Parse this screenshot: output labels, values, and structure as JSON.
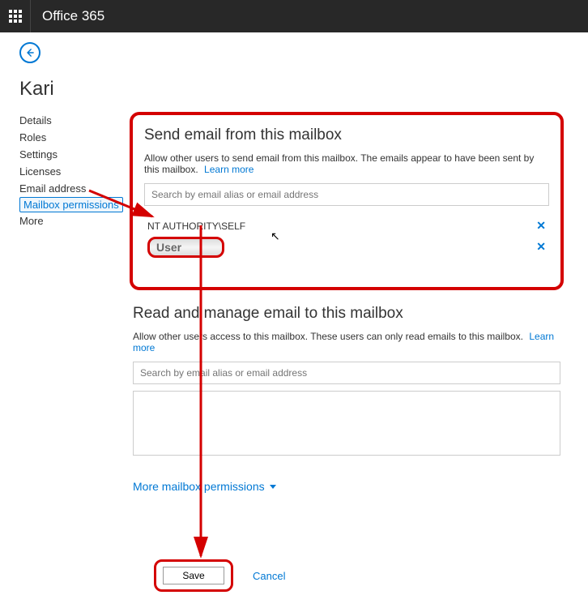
{
  "topbar": {
    "brand": "Office 365"
  },
  "page": {
    "title": "Kari"
  },
  "sidebar": {
    "items": [
      {
        "label": "Details"
      },
      {
        "label": "Roles"
      },
      {
        "label": "Settings"
      },
      {
        "label": "Licenses"
      },
      {
        "label": "Email address"
      },
      {
        "label": "Mailbox permissions"
      },
      {
        "label": "More"
      }
    ]
  },
  "send_section": {
    "title": "Send email from this mailbox",
    "desc": "Allow other users to send email from this mailbox. The emails appear to have been sent by this mailbox.",
    "learn_more": "Learn more",
    "search_placeholder": "Search by email alias or email address",
    "rows": [
      {
        "label": "NT AUTHORITY\\SELF"
      }
    ],
    "user_row": "User"
  },
  "read_section": {
    "title": "Read and manage email to this mailbox",
    "desc": "Allow other users access to this mailbox. These users can only read emails to this mailbox.",
    "learn_more": "Learn more",
    "search_placeholder": "Search by email alias or email address"
  },
  "more_permissions": {
    "label": "More mailbox permissions"
  },
  "footer": {
    "save": "Save",
    "cancel": "Cancel"
  }
}
